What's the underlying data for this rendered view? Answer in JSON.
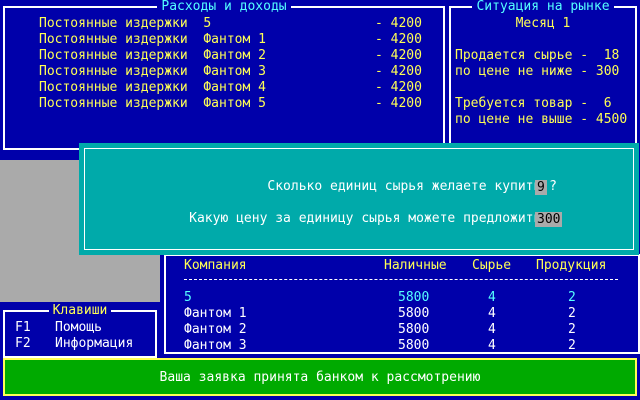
{
  "expenses": {
    "title": "Расходы и доходы",
    "rows": [
      {
        "label": "Постоянные издержки  5",
        "value": "- 4200"
      },
      {
        "label": "Постоянные издержки  Фантом 1",
        "value": "- 4200"
      },
      {
        "label": "Постоянные издержки  Фантом 2",
        "value": "- 4200"
      },
      {
        "label": "Постоянные издержки  Фантом 3",
        "value": "- 4200"
      },
      {
        "label": "Постоянные издержки  Фантом 4",
        "value": "- 4200"
      },
      {
        "label": "Постоянные издержки  Фантом 5",
        "value": "- 4200"
      }
    ]
  },
  "market": {
    "title": "Ситуация на рынке",
    "month": "Месяц 1",
    "sell_line1": "Продается сырье -  18",
    "sell_line2": "по цене не ниже - 300",
    "need_line1": "Требуется товар -  6",
    "need_line2": "по цене не выше - 4500"
  },
  "dialog": {
    "question1": "Сколько единиц сырья желаете купить ?",
    "answer1": "9",
    "question2": "Какую цену за единицу сырья можете предложить ?",
    "answer2": "300"
  },
  "companies": {
    "headers": {
      "company": "Компания",
      "cash": "Наличные",
      "raw": "Сырье",
      "product": "Продукция"
    },
    "rows": [
      {
        "company": "5",
        "cash": "5800",
        "raw": "4",
        "product": "2"
      },
      {
        "company": "Фантом 1",
        "cash": "5800",
        "raw": "4",
        "product": "2"
      },
      {
        "company": "Фантом 2",
        "cash": "5800",
        "raw": "4",
        "product": "2"
      },
      {
        "company": "Фантом 3",
        "cash": "5800",
        "raw": "4",
        "product": "2"
      }
    ]
  },
  "keys": {
    "title": "Клавиши",
    "items": [
      {
        "key": "F1",
        "label": "Помощь"
      },
      {
        "key": "F2",
        "label": "Информация"
      }
    ]
  },
  "status": {
    "message": "Ваша заявка принята банком к рассмотрению"
  },
  "colors": {
    "background": "#0000aa",
    "dialog": "#00aaaa",
    "status_bar": "#00aa00",
    "highlight": "#ffff55",
    "accent": "#55ffff"
  }
}
